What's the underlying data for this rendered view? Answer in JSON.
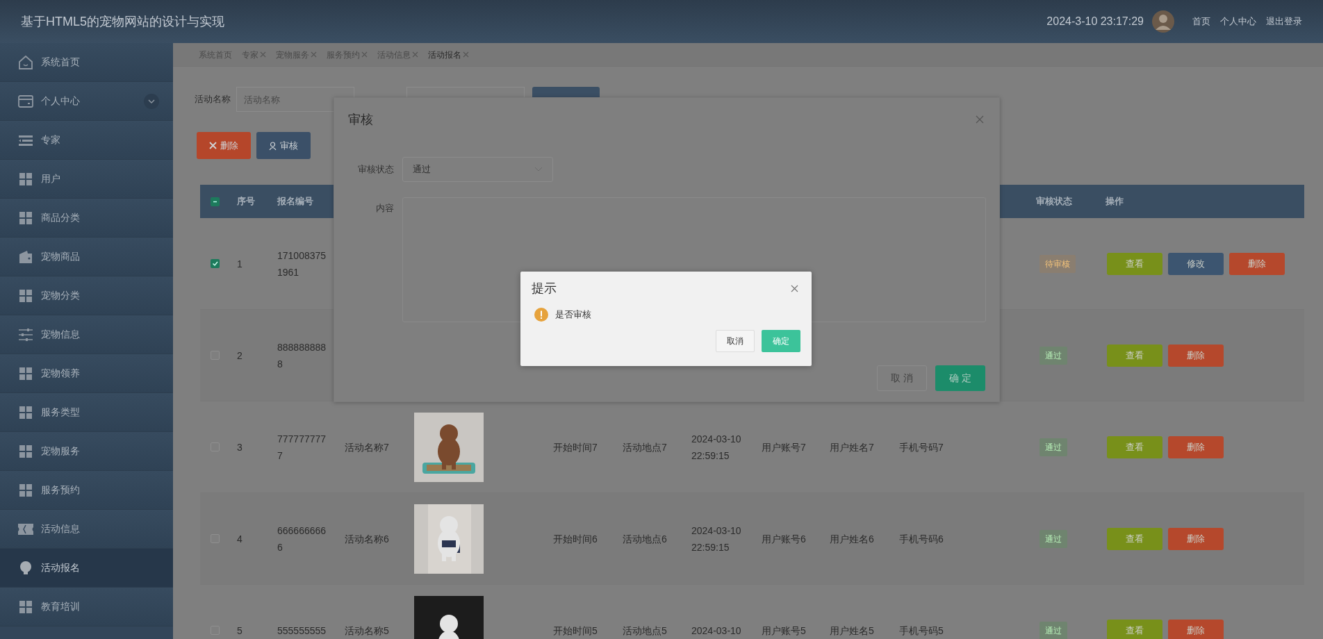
{
  "header": {
    "title": "基于HTML5的宠物网站的设计与实现",
    "datetime": "2024-3-10 23:17:29",
    "links": [
      "首页",
      "个人中心",
      "退出登录"
    ]
  },
  "sidebar": {
    "items": [
      {
        "label": "系统首页",
        "kind": "link",
        "selected": false
      },
      {
        "label": "个人中心",
        "kind": "group",
        "selected": false
      },
      {
        "label": "专家",
        "kind": "link",
        "selected": false
      },
      {
        "label": "用户",
        "kind": "link",
        "selected": false
      },
      {
        "label": "商品分类",
        "kind": "link",
        "selected": false
      },
      {
        "label": "宠物商品",
        "kind": "link",
        "selected": false
      },
      {
        "label": "宠物分类",
        "kind": "link",
        "selected": false
      },
      {
        "label": "宠物信息",
        "kind": "link",
        "selected": false
      },
      {
        "label": "宠物领养",
        "kind": "link",
        "selected": false
      },
      {
        "label": "服务类型",
        "kind": "link",
        "selected": false
      },
      {
        "label": "宠物服务",
        "kind": "link",
        "selected": false
      },
      {
        "label": "服务预约",
        "kind": "link",
        "selected": false
      },
      {
        "label": "活动信息",
        "kind": "link",
        "selected": false
      },
      {
        "label": "活动报名",
        "kind": "link",
        "selected": true
      },
      {
        "label": "教育培训",
        "kind": "link",
        "selected": false
      }
    ]
  },
  "tabs": [
    {
      "label": "系统首页",
      "closable": false,
      "selected": false
    },
    {
      "label": "专家",
      "closable": true,
      "selected": false
    },
    {
      "label": "宠物服务",
      "closable": true,
      "selected": false
    },
    {
      "label": "服务预约",
      "closable": true,
      "selected": false
    },
    {
      "label": "活动信息",
      "closable": true,
      "selected": false
    },
    {
      "label": "活动报名",
      "closable": true,
      "selected": true
    }
  ],
  "search": {
    "label": "活动名称",
    "placeholder": "活动名称"
  },
  "toolbar": [
    {
      "label": "删除",
      "kind": "delete"
    },
    {
      "label": "审核",
      "kind": "review"
    }
  ],
  "table": {
    "select_all": {
      "indeterminate": true
    },
    "columns_left": [
      "序号",
      "报名编号"
    ],
    "columns_right": [
      "审核状态",
      "操作"
    ],
    "rows": [
      {
        "checked": true,
        "index": "1",
        "signup_id": "1710083751961",
        "status": "待审核",
        "kind": "pending",
        "actions": [
          {
            "label": "查看",
            "kind": "view"
          },
          {
            "label": "修改",
            "kind": "edit"
          },
          {
            "label": "删除",
            "kind": "delete"
          }
        ]
      },
      {
        "checked": false,
        "index": "2",
        "signup_id": "8888888888",
        "status": "通过",
        "kind": "approved",
        "actions": [
          {
            "label": "查看",
            "kind": "view"
          },
          {
            "label": "删除",
            "kind": "delete"
          }
        ]
      },
      {
        "checked": false,
        "index": "3",
        "signup_id": "7777777777",
        "activity_name": "活动名称7",
        "image": {
          "kind": "picture"
        },
        "start_time": "开始时间7",
        "place": "活动地点7",
        "date": "2024-03-10 22:59:15",
        "account": "用户账号7",
        "user_name": "用户姓名7",
        "phone": "手机号码7",
        "status": "通过",
        "kind": "approved",
        "actions": [
          {
            "label": "查看",
            "kind": "view"
          },
          {
            "label": "删除",
            "kind": "delete"
          }
        ]
      },
      {
        "checked": false,
        "index": "4",
        "signup_id": "6666666666",
        "activity_name": "活动名称6",
        "image": {
          "kind": "picture"
        },
        "start_time": "开始时间6",
        "place": "活动地点6",
        "date": "2024-03-10 22:59:15",
        "account": "用户账号6",
        "user_name": "用户姓名6",
        "phone": "手机号码6",
        "status": "通过",
        "kind": "approved",
        "actions": [
          {
            "label": "查看",
            "kind": "view"
          },
          {
            "label": "删除",
            "kind": "delete"
          }
        ]
      },
      {
        "checked": false,
        "index": "5",
        "signup_id": "555555555",
        "activity_name": "活动名称5",
        "image": {
          "kind": "picture"
        },
        "start_time": "开始时间5",
        "place": "活动地点5",
        "date": "2024-03-10",
        "account": "用户账号5",
        "user_name": "用户姓名5",
        "phone": "手机号码5",
        "status": "通过",
        "kind": "approved",
        "actions": [
          {
            "label": "查看",
            "kind": "view"
          },
          {
            "label": "删除",
            "kind": "delete"
          }
        ]
      }
    ]
  },
  "review_dialog": {
    "title": "审核",
    "status_label": "审核状态",
    "status_value": "通过",
    "content_label": "内容",
    "buttons": [
      {
        "label": "取 消",
        "kind": "cancel"
      },
      {
        "label": "确 定",
        "kind": "confirm"
      }
    ]
  },
  "prompt_dialog": {
    "title": "提示",
    "message": "是否审核",
    "buttons": [
      {
        "label": "取消",
        "kind": "cancel"
      },
      {
        "label": "确定",
        "kind": "confirm"
      }
    ]
  }
}
